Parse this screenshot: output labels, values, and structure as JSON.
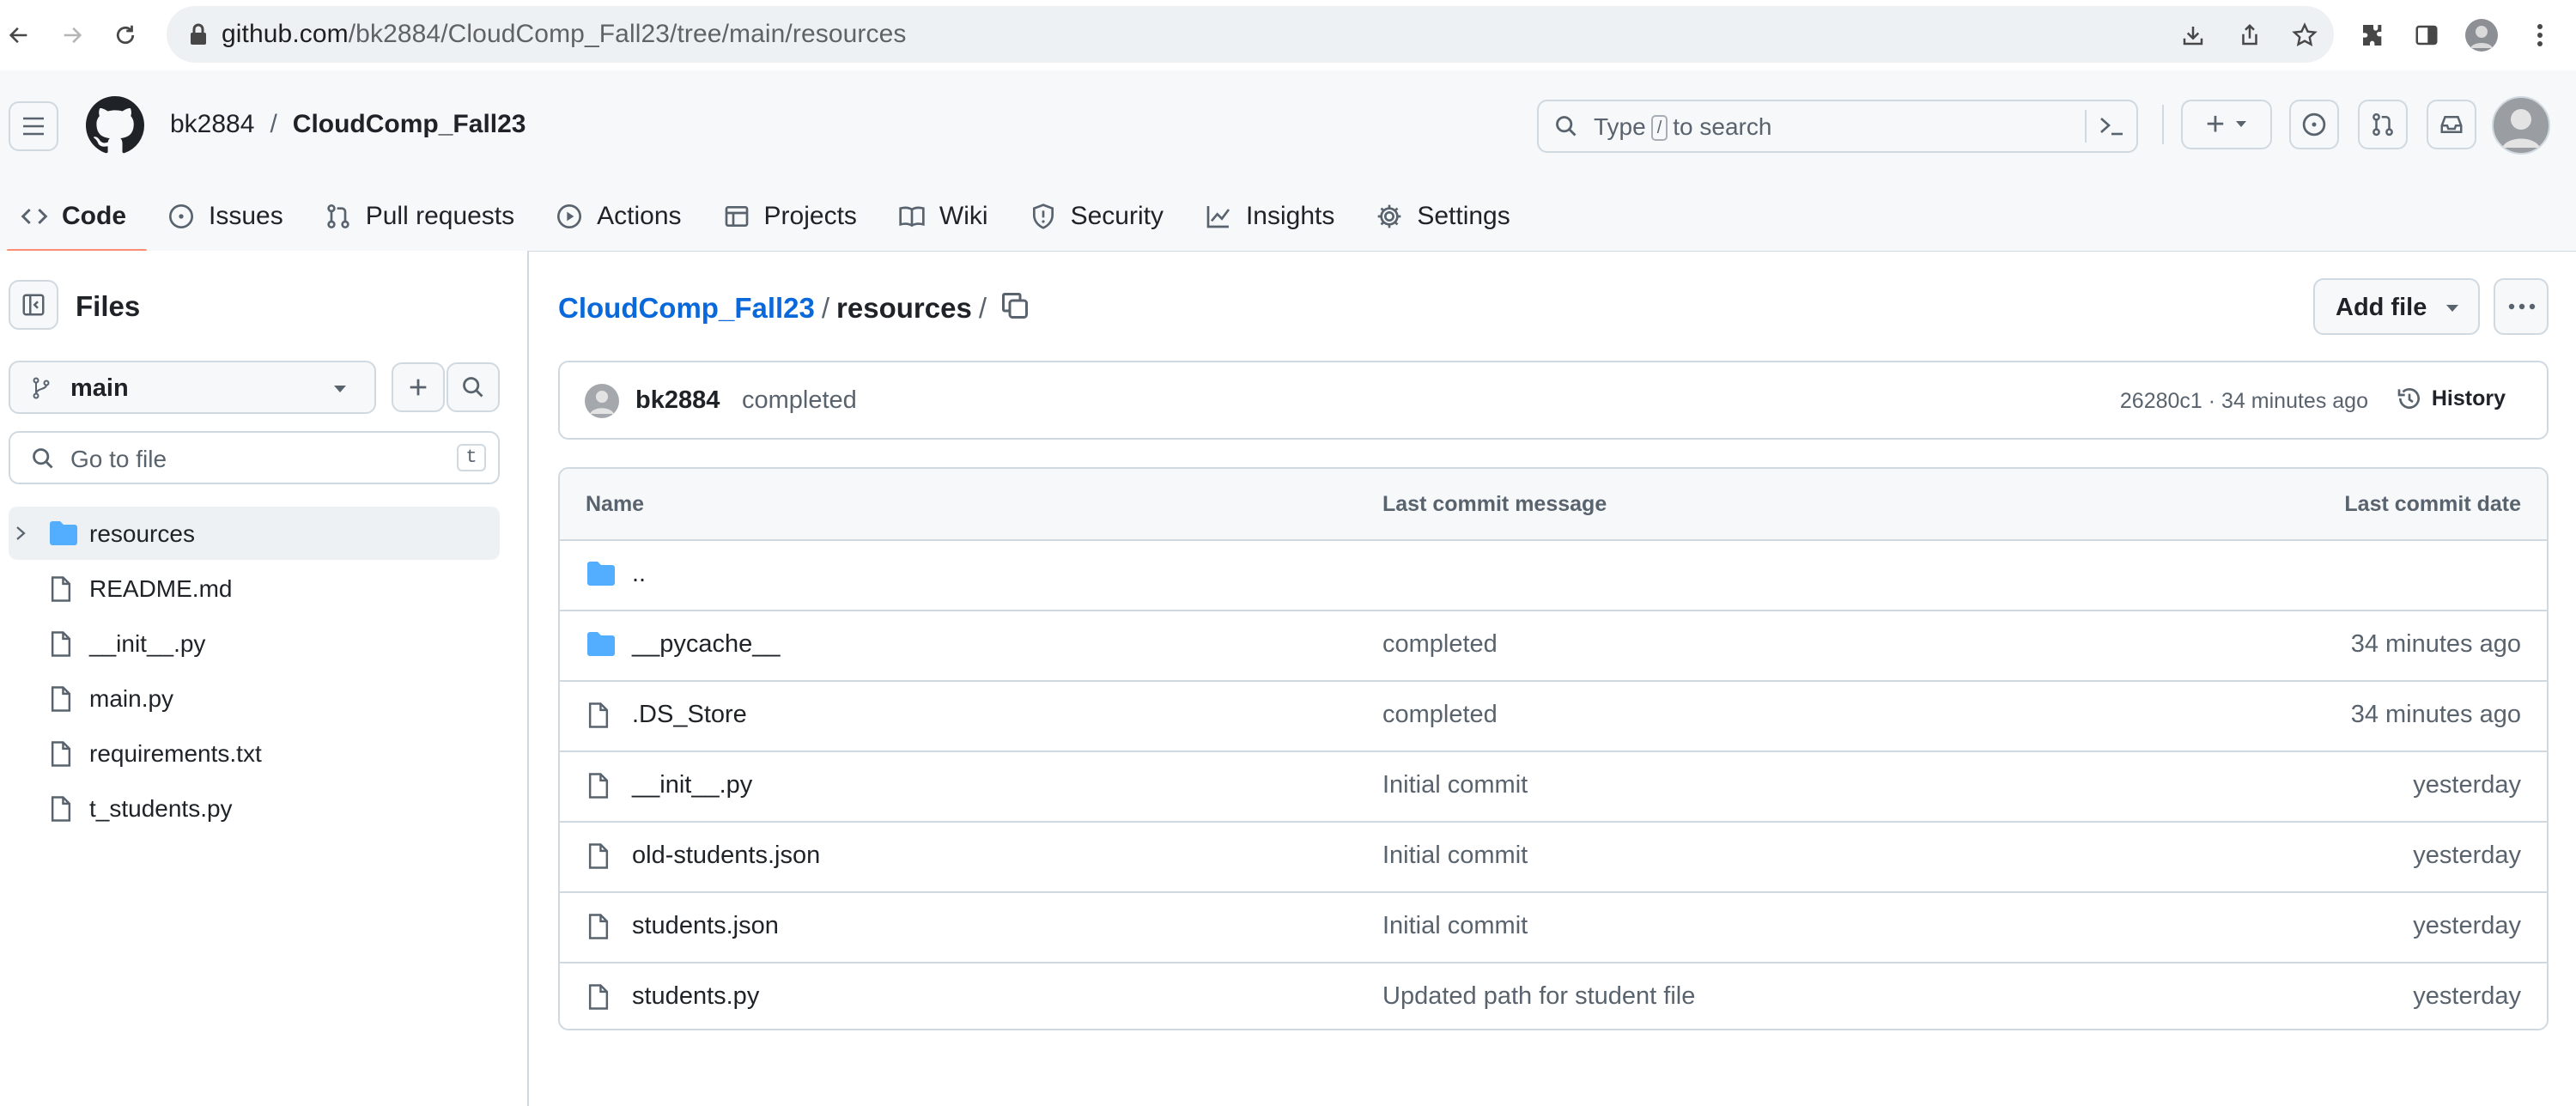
{
  "browser": {
    "url_host": "github.com",
    "url_path": "/bk2884/CloudComp_Fall23/tree/main/resources"
  },
  "header": {
    "owner": "bk2884",
    "separator": "/",
    "repo": "CloudComp_Fall23",
    "search_prefix": "Type",
    "search_key": "/",
    "search_suffix": "to search",
    "plus_label": "+"
  },
  "tabs": [
    {
      "label": "Code",
      "icon": "code-icon",
      "active": true
    },
    {
      "label": "Issues",
      "icon": "issue-icon"
    },
    {
      "label": "Pull requests",
      "icon": "pull-request-icon"
    },
    {
      "label": "Actions",
      "icon": "play-icon"
    },
    {
      "label": "Projects",
      "icon": "table-icon"
    },
    {
      "label": "Wiki",
      "icon": "book-icon"
    },
    {
      "label": "Security",
      "icon": "shield-icon"
    },
    {
      "label": "Insights",
      "icon": "graph-icon"
    },
    {
      "label": "Settings",
      "icon": "gear-icon"
    }
  ],
  "sidebar": {
    "title": "Files",
    "branch": "main",
    "goto_placeholder": "Go to file",
    "goto_key": "t",
    "items": [
      {
        "name": "resources",
        "type": "folder",
        "selected": true
      },
      {
        "name": "README.md",
        "type": "file"
      },
      {
        "name": "__init__.py",
        "type": "file"
      },
      {
        "name": "main.py",
        "type": "file"
      },
      {
        "name": "requirements.txt",
        "type": "file"
      },
      {
        "name": "t_students.py",
        "type": "file"
      }
    ]
  },
  "main": {
    "repo_link": "CloudComp_Fall23",
    "sep": "/",
    "dir": "resources",
    "trailing_sep": "/",
    "add_file": "Add file",
    "commit": {
      "author": "bk2884",
      "message": "completed",
      "sha_time": "26280c1 · 34 minutes ago",
      "history": "History"
    },
    "table": {
      "headers": [
        "Name",
        "Last commit message",
        "Last commit date"
      ],
      "rows": [
        {
          "name": "..",
          "type": "folder",
          "message": "",
          "date": ""
        },
        {
          "name": "__pycache__",
          "type": "folder",
          "message": "completed",
          "date": "34 minutes ago"
        },
        {
          "name": ".DS_Store",
          "type": "file",
          "message": "completed",
          "date": "34 minutes ago"
        },
        {
          "name": "__init__.py",
          "type": "file",
          "message": "Initial commit",
          "date": "yesterday"
        },
        {
          "name": "old-students.json",
          "type": "file",
          "message": "Initial commit",
          "date": "yesterday"
        },
        {
          "name": "students.json",
          "type": "file",
          "message": "Initial commit",
          "date": "yesterday"
        },
        {
          "name": "students.py",
          "type": "file",
          "message": "Updated path for student file",
          "date": "yesterday"
        }
      ]
    }
  },
  "colors": {
    "link": "#0969da",
    "folder": "#54aeff",
    "active_tab_underline": "#fd8c73"
  }
}
